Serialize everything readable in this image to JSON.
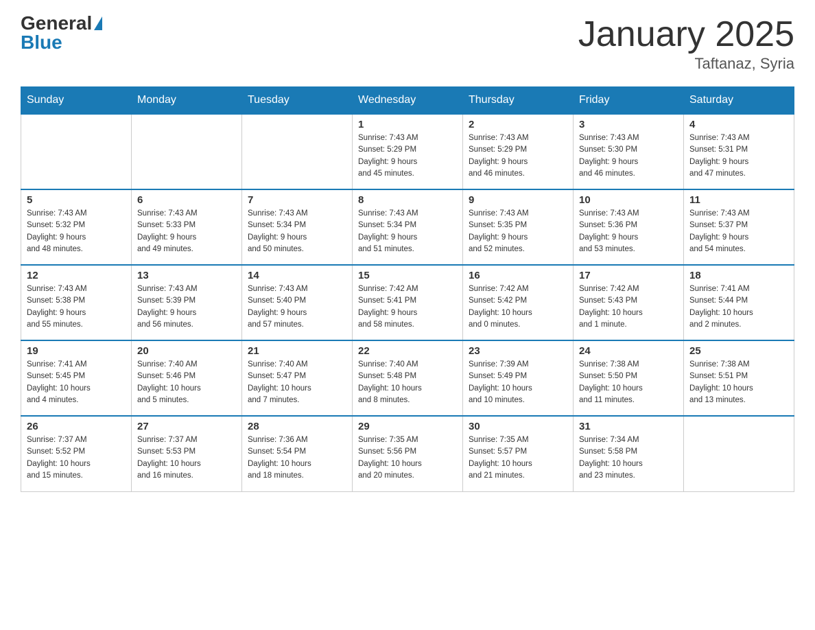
{
  "header": {
    "logo_general": "General",
    "logo_blue": "Blue",
    "month_title": "January 2025",
    "location": "Taftanaz, Syria"
  },
  "weekdays": [
    "Sunday",
    "Monday",
    "Tuesday",
    "Wednesday",
    "Thursday",
    "Friday",
    "Saturday"
  ],
  "weeks": [
    [
      {
        "day": "",
        "info": ""
      },
      {
        "day": "",
        "info": ""
      },
      {
        "day": "",
        "info": ""
      },
      {
        "day": "1",
        "info": "Sunrise: 7:43 AM\nSunset: 5:29 PM\nDaylight: 9 hours\nand 45 minutes."
      },
      {
        "day": "2",
        "info": "Sunrise: 7:43 AM\nSunset: 5:29 PM\nDaylight: 9 hours\nand 46 minutes."
      },
      {
        "day": "3",
        "info": "Sunrise: 7:43 AM\nSunset: 5:30 PM\nDaylight: 9 hours\nand 46 minutes."
      },
      {
        "day": "4",
        "info": "Sunrise: 7:43 AM\nSunset: 5:31 PM\nDaylight: 9 hours\nand 47 minutes."
      }
    ],
    [
      {
        "day": "5",
        "info": "Sunrise: 7:43 AM\nSunset: 5:32 PM\nDaylight: 9 hours\nand 48 minutes."
      },
      {
        "day": "6",
        "info": "Sunrise: 7:43 AM\nSunset: 5:33 PM\nDaylight: 9 hours\nand 49 minutes."
      },
      {
        "day": "7",
        "info": "Sunrise: 7:43 AM\nSunset: 5:34 PM\nDaylight: 9 hours\nand 50 minutes."
      },
      {
        "day": "8",
        "info": "Sunrise: 7:43 AM\nSunset: 5:34 PM\nDaylight: 9 hours\nand 51 minutes."
      },
      {
        "day": "9",
        "info": "Sunrise: 7:43 AM\nSunset: 5:35 PM\nDaylight: 9 hours\nand 52 minutes."
      },
      {
        "day": "10",
        "info": "Sunrise: 7:43 AM\nSunset: 5:36 PM\nDaylight: 9 hours\nand 53 minutes."
      },
      {
        "day": "11",
        "info": "Sunrise: 7:43 AM\nSunset: 5:37 PM\nDaylight: 9 hours\nand 54 minutes."
      }
    ],
    [
      {
        "day": "12",
        "info": "Sunrise: 7:43 AM\nSunset: 5:38 PM\nDaylight: 9 hours\nand 55 minutes."
      },
      {
        "day": "13",
        "info": "Sunrise: 7:43 AM\nSunset: 5:39 PM\nDaylight: 9 hours\nand 56 minutes."
      },
      {
        "day": "14",
        "info": "Sunrise: 7:43 AM\nSunset: 5:40 PM\nDaylight: 9 hours\nand 57 minutes."
      },
      {
        "day": "15",
        "info": "Sunrise: 7:42 AM\nSunset: 5:41 PM\nDaylight: 9 hours\nand 58 minutes."
      },
      {
        "day": "16",
        "info": "Sunrise: 7:42 AM\nSunset: 5:42 PM\nDaylight: 10 hours\nand 0 minutes."
      },
      {
        "day": "17",
        "info": "Sunrise: 7:42 AM\nSunset: 5:43 PM\nDaylight: 10 hours\nand 1 minute."
      },
      {
        "day": "18",
        "info": "Sunrise: 7:41 AM\nSunset: 5:44 PM\nDaylight: 10 hours\nand 2 minutes."
      }
    ],
    [
      {
        "day": "19",
        "info": "Sunrise: 7:41 AM\nSunset: 5:45 PM\nDaylight: 10 hours\nand 4 minutes."
      },
      {
        "day": "20",
        "info": "Sunrise: 7:40 AM\nSunset: 5:46 PM\nDaylight: 10 hours\nand 5 minutes."
      },
      {
        "day": "21",
        "info": "Sunrise: 7:40 AM\nSunset: 5:47 PM\nDaylight: 10 hours\nand 7 minutes."
      },
      {
        "day": "22",
        "info": "Sunrise: 7:40 AM\nSunset: 5:48 PM\nDaylight: 10 hours\nand 8 minutes."
      },
      {
        "day": "23",
        "info": "Sunrise: 7:39 AM\nSunset: 5:49 PM\nDaylight: 10 hours\nand 10 minutes."
      },
      {
        "day": "24",
        "info": "Sunrise: 7:38 AM\nSunset: 5:50 PM\nDaylight: 10 hours\nand 11 minutes."
      },
      {
        "day": "25",
        "info": "Sunrise: 7:38 AM\nSunset: 5:51 PM\nDaylight: 10 hours\nand 13 minutes."
      }
    ],
    [
      {
        "day": "26",
        "info": "Sunrise: 7:37 AM\nSunset: 5:52 PM\nDaylight: 10 hours\nand 15 minutes."
      },
      {
        "day": "27",
        "info": "Sunrise: 7:37 AM\nSunset: 5:53 PM\nDaylight: 10 hours\nand 16 minutes."
      },
      {
        "day": "28",
        "info": "Sunrise: 7:36 AM\nSunset: 5:54 PM\nDaylight: 10 hours\nand 18 minutes."
      },
      {
        "day": "29",
        "info": "Sunrise: 7:35 AM\nSunset: 5:56 PM\nDaylight: 10 hours\nand 20 minutes."
      },
      {
        "day": "30",
        "info": "Sunrise: 7:35 AM\nSunset: 5:57 PM\nDaylight: 10 hours\nand 21 minutes."
      },
      {
        "day": "31",
        "info": "Sunrise: 7:34 AM\nSunset: 5:58 PM\nDaylight: 10 hours\nand 23 minutes."
      },
      {
        "day": "",
        "info": ""
      }
    ]
  ]
}
